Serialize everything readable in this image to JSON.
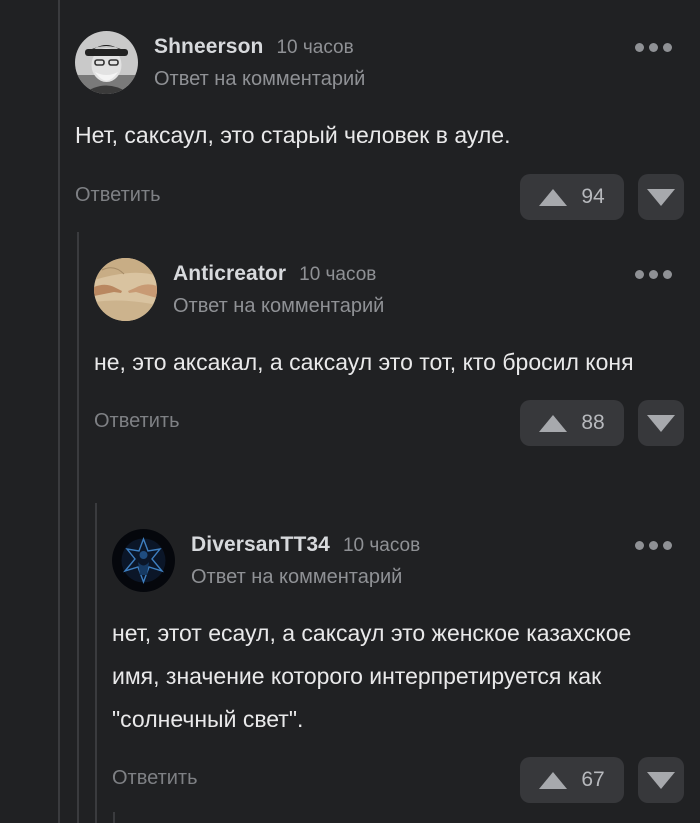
{
  "colors": {
    "background": "#202123",
    "text": "#e9e9ea",
    "muted": "#8f9195",
    "button_bg": "#37383b",
    "thread_line": "#3a3b3e"
  },
  "comments": [
    {
      "username": "Shneerson",
      "time": "10 часов",
      "reply_label": "Ответ на комментарий",
      "text": "Нет, саксаул, это старый человек в ауле.",
      "action_label": "Ответить",
      "score": "94",
      "avatar_icon": "old-man-photo",
      "more_icon": "ellipsis-icon"
    },
    {
      "username": "Anticreator",
      "time": "10 часов",
      "reply_label": "Ответ на комментарий",
      "text": "не, это аксакал, а саксаул это тот, кто бросил коня",
      "action_label": "Ответить",
      "score": "88",
      "avatar_icon": "creation-of-adam-hands",
      "more_icon": "ellipsis-icon"
    },
    {
      "username": "DiversanTT34",
      "time": "10 часов",
      "reply_label": "Ответ на комментарий",
      "text": "нет, этот есаул, а саксаул это женское казахское имя, значение которого интерпретируется как \"солнечный свет\".",
      "action_label": "Ответить",
      "score": "67",
      "avatar_icon": "dark-blue-figure",
      "more_icon": "ellipsis-icon"
    }
  ]
}
